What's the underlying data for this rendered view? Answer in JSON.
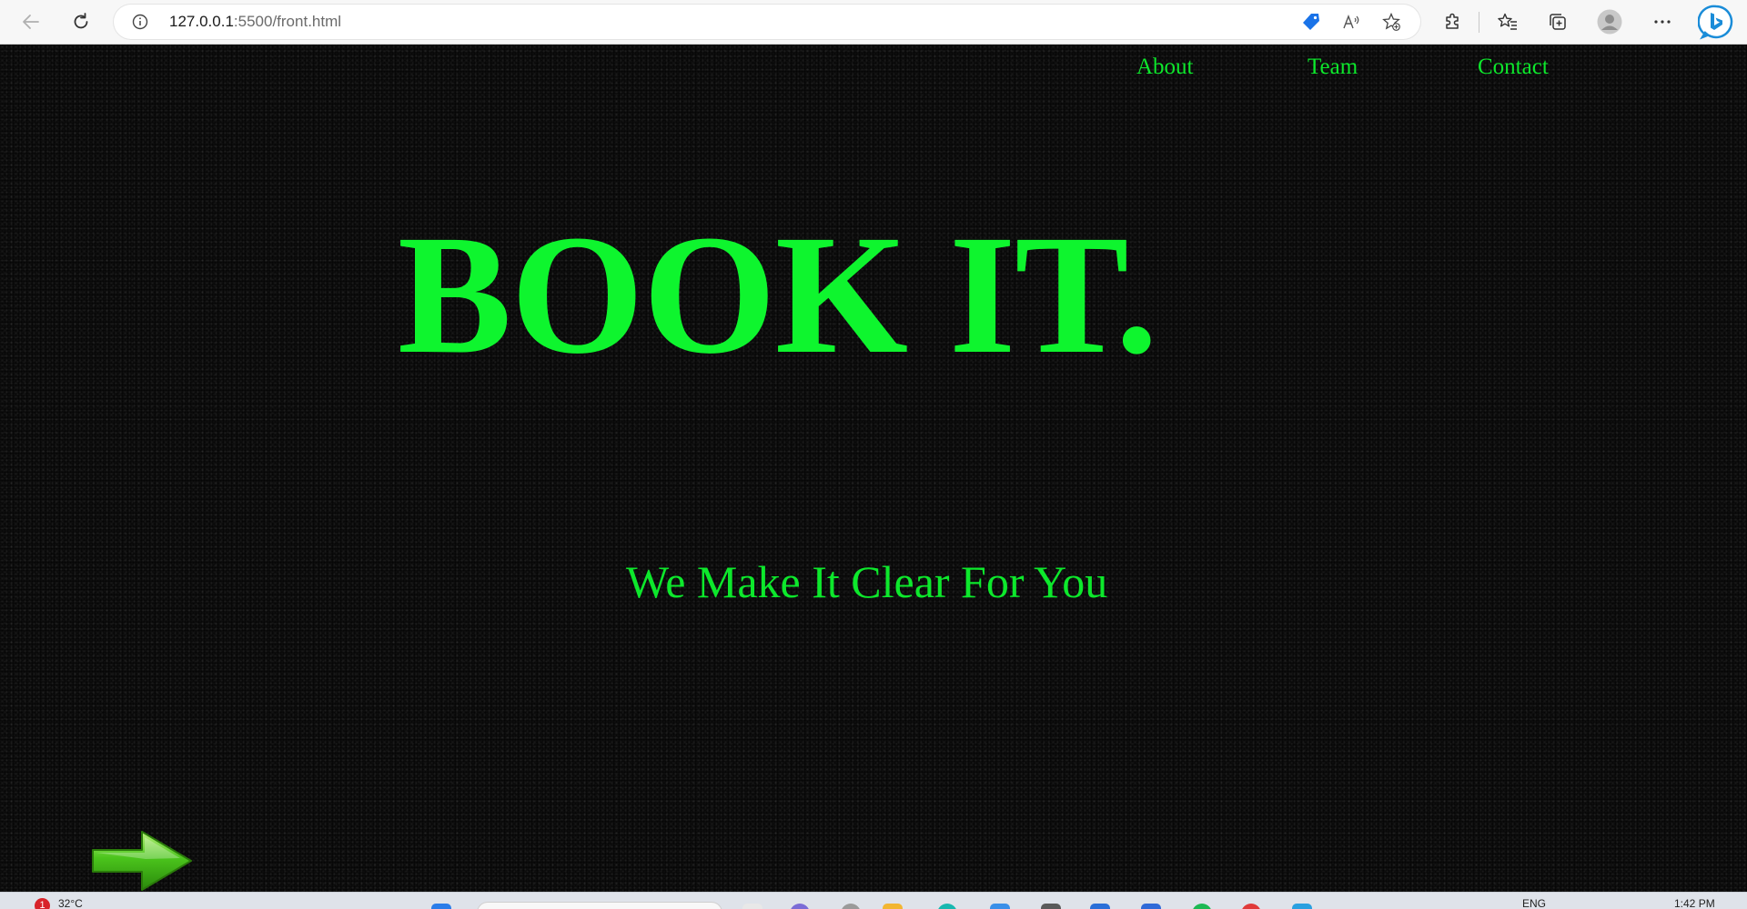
{
  "browser": {
    "url_host": "127.0.0.1",
    "url_path": ":5500/front.html",
    "icons": [
      "back-arrow-icon",
      "refresh-icon",
      "info-icon",
      "price-tag-icon",
      "read-aloud-icon",
      "add-favorite-icon",
      "extensions-icon",
      "favorites-icon",
      "collections-icon",
      "profile-avatar-icon",
      "more-options-icon",
      "bing-copilot-icon"
    ]
  },
  "page": {
    "nav": [
      {
        "label": "About"
      },
      {
        "label": "Team"
      },
      {
        "label": "Contact"
      }
    ],
    "title": "BOOK IT.",
    "subtitle": "We Make It Clear For You",
    "accent_color": "#0ef52e",
    "background_color": "#0f0f0f",
    "next_icon": "green-right-arrow-icon"
  },
  "taskbar": {
    "weather_badge": "1",
    "temperature": "32°C",
    "language": "ENG",
    "time": "1:42 PM"
  }
}
